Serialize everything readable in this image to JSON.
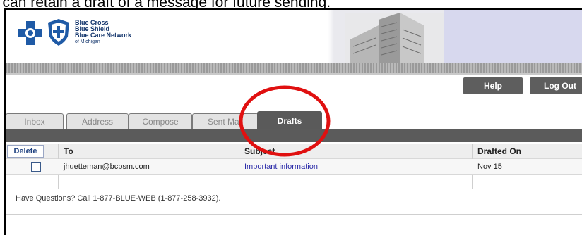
{
  "caption": "u can retain a draft of a message for future sending.",
  "brand": {
    "line1": "Blue Cross",
    "line2": "Blue Shield",
    "line3": "Blue Care Network",
    "line4": "of Michigan"
  },
  "header_buttons": {
    "help": "Help",
    "logout": "Log Out"
  },
  "tabs": [
    {
      "label": "Inbox"
    },
    {
      "label": "Address"
    },
    {
      "label": "Compose"
    },
    {
      "label": "Sent Mail"
    },
    {
      "label": "Drafts",
      "active": true
    }
  ],
  "table": {
    "delete_label": "Delete",
    "columns": {
      "to": "To",
      "subject": "Subject",
      "drafted_on": "Drafted On"
    },
    "rows": [
      {
        "to": "jhuetteman@bcbsm.com",
        "subject": "Important information",
        "drafted_on": "Nov 15"
      }
    ]
  },
  "footer": {
    "help_text": "Have Questions? Call 1-877-BLUE-WEB (1-877-258-3932)."
  },
  "colors": {
    "brand_blue": "#1f5aa6",
    "annotation_red": "#e01010",
    "tab_active": "#5a5a5a"
  }
}
